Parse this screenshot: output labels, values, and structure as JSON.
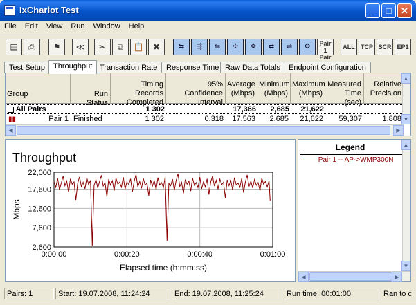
{
  "window": {
    "title": "IxChariot Test"
  },
  "menu": [
    "File",
    "Edit",
    "View",
    "Run",
    "Window",
    "Help"
  ],
  "toolbar": {
    "pair_label_1": "Pair 1",
    "pair_label_2": "Pair 2",
    "all": "ALL",
    "tcp": "TCP",
    "scr": "SCR",
    "ep1": "EP1"
  },
  "tabs": [
    "Test Setup",
    "Throughput",
    "Transaction Rate",
    "Response Time",
    "Raw Data Totals",
    "Endpoint Configuration"
  ],
  "active_tab": "Throughput",
  "grid": {
    "columns": [
      {
        "label": "Group"
      },
      {
        "label": "Run Status"
      },
      {
        "label": "Timing Records Completed"
      },
      {
        "label": "95% Confidence Interval"
      },
      {
        "label": "Average (Mbps)"
      },
      {
        "label": "Minimum (Mbps)"
      },
      {
        "label": "Maximum (Mbps)"
      },
      {
        "label": "Measured Time (sec)"
      },
      {
        "label": "Relative Precision"
      }
    ],
    "rows": [
      {
        "group": "All Pairs",
        "status": "",
        "records": "1 302",
        "ci": "",
        "avg": "17,366",
        "min": "2,685",
        "max": "21,622",
        "time": "",
        "prec": ""
      },
      {
        "group": "Pair 1",
        "status": "Finished",
        "records": "1 302",
        "ci": "0,318",
        "avg": "17,563",
        "min": "2,685",
        "max": "21,622",
        "time": "59,307",
        "prec": "1,808"
      }
    ]
  },
  "chart_data": {
    "type": "line",
    "title": "Throughput",
    "xlabel": "Elapsed time (h:mm:ss)",
    "ylabel": "Mbps",
    "x_ticks": [
      "0:00:00",
      "0:00:20",
      "0:00:40",
      "0:01:00"
    ],
    "y_ticks": [
      "22,000",
      "17,600",
      "12,600",
      "7,600",
      "2,600"
    ],
    "xlim": [
      0,
      60
    ],
    "ylim": [
      2600,
      22000
    ],
    "series": [
      {
        "name": "Pair 1 -- AP->WMP300N",
        "color": "#8b0000",
        "points": [
          [
            0.0,
            19600
          ],
          [
            0.5,
            18100
          ],
          [
            1.0,
            20400
          ],
          [
            1.5,
            17400
          ],
          [
            2.0,
            19200
          ],
          [
            2.5,
            21000
          ],
          [
            3.0,
            18500
          ],
          [
            3.5,
            19700
          ],
          [
            4.0,
            16800
          ],
          [
            4.5,
            20300
          ],
          [
            5.0,
            18900
          ],
          [
            5.5,
            19500
          ],
          [
            6.0,
            14800
          ],
          [
            6.5,
            19100
          ],
          [
            7.0,
            20800
          ],
          [
            7.5,
            18300
          ],
          [
            8.0,
            19400
          ],
          [
            8.5,
            17700
          ],
          [
            9.0,
            20600
          ],
          [
            9.5,
            18800
          ],
          [
            10.0,
            19900
          ],
          [
            10.5,
            2900
          ],
          [
            11.0,
            18600
          ],
          [
            11.5,
            20100
          ],
          [
            12.0,
            17900
          ],
          [
            12.5,
            19600
          ],
          [
            13.0,
            21200
          ],
          [
            13.5,
            18400
          ],
          [
            14.0,
            19300
          ],
          [
            14.5,
            15600
          ],
          [
            15.0,
            20200
          ],
          [
            15.5,
            18700
          ],
          [
            16.0,
            19800
          ],
          [
            16.5,
            17200
          ],
          [
            17.0,
            20500
          ],
          [
            17.5,
            18900
          ],
          [
            18.0,
            19400
          ],
          [
            18.5,
            18100
          ],
          [
            19.0,
            20700
          ],
          [
            19.5,
            17600
          ],
          [
            20.0,
            19500
          ],
          [
            20.5,
            18800
          ],
          [
            21.0,
            20300
          ],
          [
            21.5,
            16900
          ],
          [
            22.0,
            19700
          ],
          [
            22.5,
            21400
          ],
          [
            23.0,
            18200
          ],
          [
            23.5,
            19600
          ],
          [
            24.0,
            17800
          ],
          [
            24.5,
            20400
          ],
          [
            25.0,
            18600
          ],
          [
            25.5,
            19200
          ],
          [
            26.0,
            15900
          ],
          [
            26.5,
            20000
          ],
          [
            27.0,
            18400
          ],
          [
            27.5,
            19900
          ],
          [
            28.0,
            17500
          ],
          [
            28.5,
            20600
          ],
          [
            29.0,
            18700
          ],
          [
            29.5,
            19300
          ],
          [
            30.0,
            18000
          ],
          [
            30.5,
            20800
          ],
          [
            31.0,
            4200
          ],
          [
            31.5,
            19100
          ],
          [
            32.0,
            18500
          ],
          [
            32.5,
            20200
          ],
          [
            33.0,
            17300
          ],
          [
            33.5,
            19800
          ],
          [
            34.0,
            21600
          ],
          [
            34.5,
            18300
          ],
          [
            35.0,
            19400
          ],
          [
            35.5,
            16500
          ],
          [
            36.0,
            20100
          ],
          [
            36.5,
            18900
          ],
          [
            37.0,
            19700
          ],
          [
            37.5,
            17100
          ],
          [
            38.0,
            20500
          ],
          [
            38.5,
            18600
          ],
          [
            39.0,
            19300
          ],
          [
            39.5,
            18000
          ],
          [
            40.0,
            20700
          ],
          [
            40.5,
            17700
          ],
          [
            41.0,
            19500
          ],
          [
            41.5,
            18200
          ],
          [
            42.0,
            20300
          ],
          [
            42.5,
            16200
          ],
          [
            43.0,
            19600
          ],
          [
            43.5,
            21000
          ],
          [
            44.0,
            18400
          ],
          [
            44.5,
            19900
          ],
          [
            45.0,
            17600
          ],
          [
            45.5,
            20200
          ],
          [
            46.0,
            18800
          ],
          [
            46.5,
            19400
          ],
          [
            47.0,
            15300
          ],
          [
            47.5,
            20000
          ],
          [
            48.0,
            18500
          ],
          [
            48.5,
            19800
          ],
          [
            49.0,
            17400
          ],
          [
            49.5,
            20600
          ],
          [
            50.0,
            18700
          ],
          [
            50.5,
            19200
          ],
          [
            51.0,
            18100
          ],
          [
            51.5,
            20400
          ],
          [
            52.0,
            16700
          ],
          [
            52.5,
            19500
          ],
          [
            53.0,
            21300
          ],
          [
            53.5,
            18300
          ],
          [
            54.0,
            19700
          ],
          [
            54.5,
            17900
          ],
          [
            55.0,
            20100
          ],
          [
            55.5,
            18600
          ],
          [
            56.0,
            19300
          ],
          [
            56.5,
            17200
          ],
          [
            57.0,
            20500
          ],
          [
            57.5,
            18900
          ],
          [
            58.0,
            19600
          ],
          [
            58.5,
            18200
          ],
          [
            59.0,
            19800
          ],
          [
            59.3,
            14600
          ]
        ]
      }
    ]
  },
  "legend": {
    "title": "Legend",
    "items": [
      {
        "label": "Pair 1 -- AP->WMP300N",
        "color": "#8b0000"
      }
    ]
  },
  "status": {
    "pairs": "Pairs: 1",
    "start": "Start: 19.07.2008, 11:24:24",
    "end": "End: 19.07.2008, 11:25:24",
    "run_time": "Run time: 00:01:00",
    "ran_to": "Ran to c"
  }
}
